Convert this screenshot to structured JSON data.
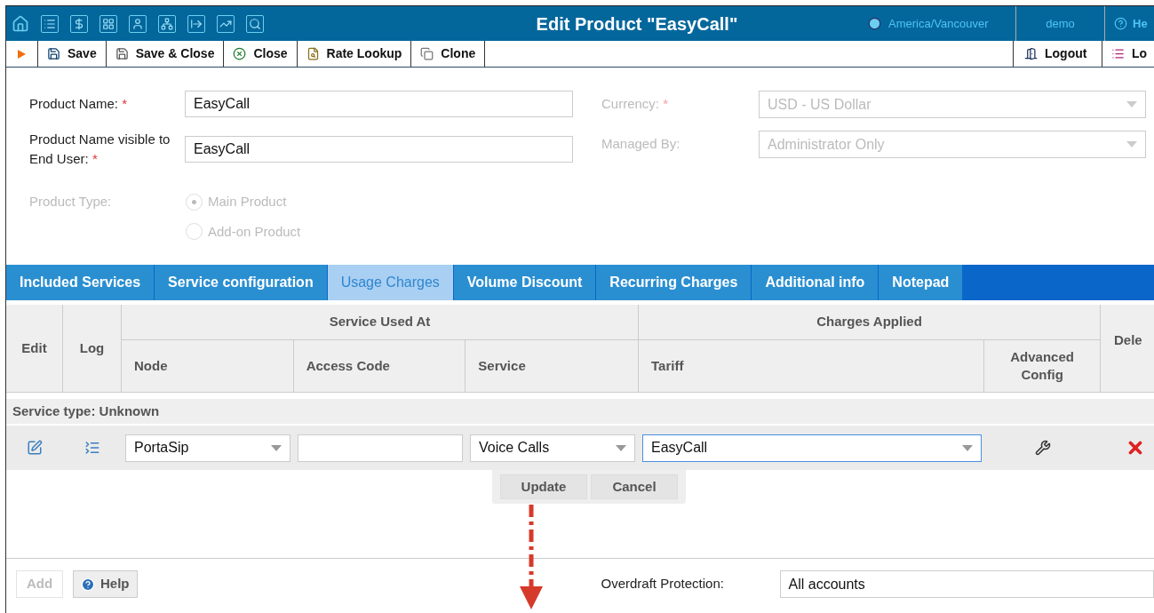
{
  "header": {
    "title": "Edit Product \"EasyCall\"",
    "timezone": "America/Vancouver",
    "user": "demo",
    "help": "He"
  },
  "toolbar": {
    "buttons": [
      {
        "label": "Save",
        "kind": "save"
      },
      {
        "label": "Save & Close",
        "kind": "save_close"
      },
      {
        "label": "Close",
        "kind": "close"
      },
      {
        "label": "Rate Lookup",
        "kind": "lookup"
      },
      {
        "label": "Clone",
        "kind": "clone"
      }
    ],
    "right_buttons": [
      {
        "label": "Logout",
        "kind": "logout"
      },
      {
        "label": "Lo",
        "kind": "log"
      }
    ]
  },
  "form": {
    "left": [
      {
        "label": "Product Name:",
        "required_mark": "*",
        "value": "EasyCall"
      },
      {
        "label": "Product Name visible to End User:",
        "required_mark": "*",
        "value": "EasyCall"
      }
    ],
    "product_type": {
      "label": "Product Type:",
      "disabled": true,
      "options": [
        {
          "label": "Main Product",
          "selected": true
        },
        {
          "label": "Add-on Product",
          "selected": false
        }
      ]
    },
    "right": [
      {
        "label": "Currency:",
        "required_mark": "*",
        "value": "USD - US Dollar",
        "disabled": true
      },
      {
        "label": "Managed By:",
        "value": "Administrator Only",
        "disabled": true
      }
    ]
  },
  "tabs": [
    {
      "label": "Included Services",
      "selected": false
    },
    {
      "label": "Service configuration",
      "selected": false
    },
    {
      "label": "Usage Charges",
      "selected": true
    },
    {
      "label": "Volume Discount",
      "selected": false
    },
    {
      "label": "Recurring Charges",
      "selected": false
    },
    {
      "label": "Additional info",
      "selected": false
    },
    {
      "label": "Notepad",
      "selected": false
    }
  ],
  "table": {
    "edit_header": "Edit",
    "log_header": "Log",
    "group_headers": [
      "Service Used At",
      "Charges Applied"
    ],
    "columns": [
      "Node",
      "Access Code",
      "Service",
      "Tariff",
      "Advanced Config"
    ],
    "delete_header": "Dele",
    "section": "Service type: Unknown",
    "rows": [
      {
        "node": "PortaSip",
        "access_code": "",
        "service": "Voice Calls",
        "tariff": "EasyCall"
      }
    ],
    "row_actions": [
      "Update",
      "Cancel"
    ]
  },
  "footer": {
    "add": {
      "label": "Add",
      "disabled": true
    },
    "help": "Help",
    "overdraft": {
      "label": "Overdraft Protection:",
      "value": "All accounts"
    }
  }
}
